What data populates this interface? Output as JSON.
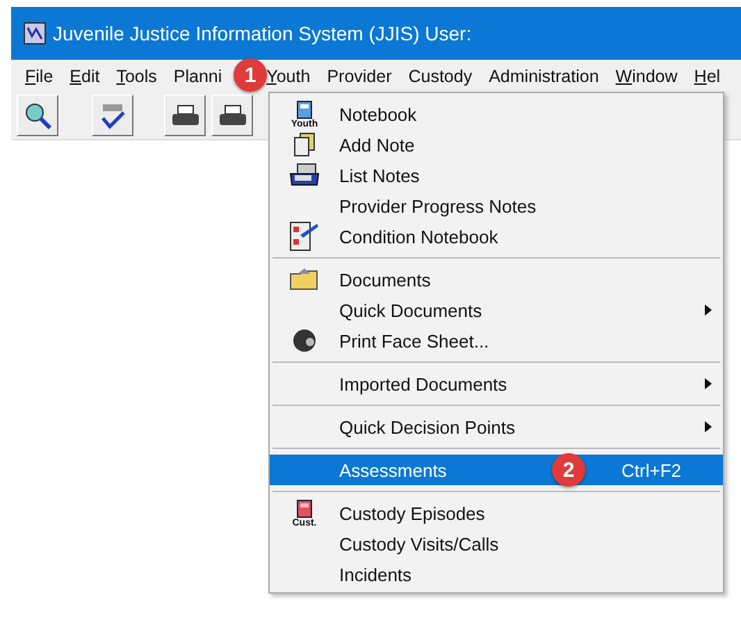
{
  "window": {
    "title": "Juvenile Justice Information System (JJIS)  User:"
  },
  "menu_bar": [
    {
      "mnemonic": "F",
      "rest": "ile"
    },
    {
      "mnemonic": "E",
      "rest": "dit"
    },
    {
      "mnemonic": "T",
      "rest": "ools"
    },
    {
      "label": "Planni"
    },
    {
      "mnemonic": "Y",
      "rest": "outh"
    },
    {
      "label": "Provider"
    },
    {
      "label": "Custody"
    },
    {
      "label": "Administration"
    },
    {
      "mnemonic": "W",
      "rest": "indow"
    },
    {
      "mnemonic": "H",
      "rest": "el"
    }
  ],
  "youth_menu": [
    {
      "kind": "item",
      "label": "Notebook",
      "icon_caption": "Youth",
      "submenu": false,
      "selected": false
    },
    {
      "kind": "item",
      "label": "Add Note",
      "submenu": false,
      "selected": false
    },
    {
      "kind": "item",
      "label": "List Notes",
      "submenu": false,
      "selected": false
    },
    {
      "kind": "item",
      "label": "Provider Progress Notes",
      "submenu": false,
      "selected": false
    },
    {
      "kind": "item",
      "label": "Condition Notebook",
      "submenu": false,
      "selected": false
    },
    {
      "kind": "separator"
    },
    {
      "kind": "item",
      "label": "Documents",
      "submenu": false,
      "selected": false
    },
    {
      "kind": "item",
      "label": "Quick Documents",
      "submenu": true,
      "selected": false
    },
    {
      "kind": "item",
      "label": "Print Face Sheet...",
      "submenu": false,
      "selected": false
    },
    {
      "kind": "separator"
    },
    {
      "kind": "item",
      "label": "Imported Documents",
      "submenu": true,
      "selected": false
    },
    {
      "kind": "separator"
    },
    {
      "kind": "item",
      "label": "Quick Decision Points",
      "submenu": true,
      "selected": false
    },
    {
      "kind": "separator"
    },
    {
      "kind": "item",
      "label": "Assessments",
      "shortcut": "Ctrl+F2",
      "submenu": false,
      "selected": true
    },
    {
      "kind": "separator"
    },
    {
      "kind": "item",
      "label": "Custody Episodes",
      "icon_caption": "Cust.",
      "submenu": false,
      "selected": false
    },
    {
      "kind": "item",
      "label": "Custody Visits/Calls",
      "submenu": false,
      "selected": false
    },
    {
      "kind": "item",
      "label": "Incidents",
      "submenu": false,
      "selected": false
    }
  ],
  "callouts": [
    {
      "number": "1"
    },
    {
      "number": "2"
    }
  ]
}
